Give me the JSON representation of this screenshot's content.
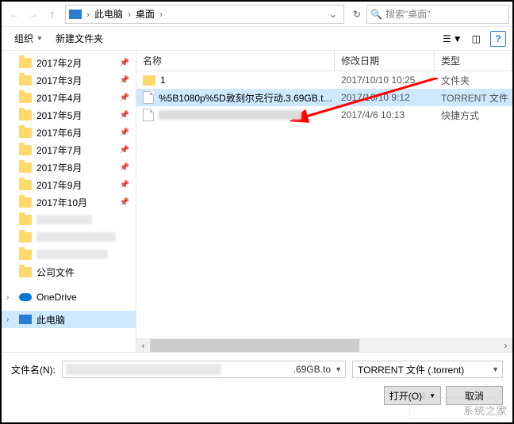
{
  "address": {
    "crumbs": [
      "此电脑",
      "桌面"
    ],
    "separator": "›"
  },
  "search": {
    "placeholder": "搜索\"桌面\""
  },
  "toolbar": {
    "organize": "组织",
    "new_folder": "新建文件夹"
  },
  "sidebar": {
    "months": [
      "2017年2月",
      "2017年3月",
      "2017年4月",
      "2017年5月",
      "2017年6月",
      "2017年7月",
      "2017年8月",
      "2017年9月",
      "2017年10月"
    ],
    "company": "公司文件",
    "onedrive": "OneDrive",
    "this_pc": "此电脑"
  },
  "columns": {
    "name": "名称",
    "date": "修改日期",
    "type": "类型"
  },
  "rows": [
    {
      "icon": "folder",
      "name": "1",
      "date": "2017/10/10 10:25",
      "type": "文件夹",
      "selected": false
    },
    {
      "icon": "file",
      "name": "%5B1080p%5D敦刻尔克行动.3.69GB.t…",
      "date": "2017/10/10 9:12",
      "type": "TORRENT 文件",
      "selected": true
    },
    {
      "icon": "file",
      "name": "",
      "date": "2017/4/6 10:13",
      "type": "快捷方式",
      "selected": false,
      "blur": true
    }
  ],
  "filename": {
    "label": "文件名(N):",
    "suffix": ".69GB.to",
    "type_filter": "TORRENT 文件 (.torrent)"
  },
  "buttons": {
    "open": "打开(O)",
    "cancel": "取消"
  },
  "watermark": "系统之家"
}
